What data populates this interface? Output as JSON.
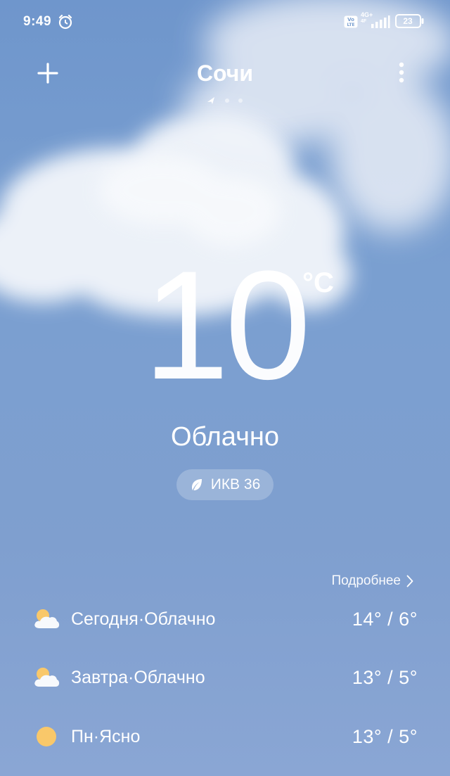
{
  "status_bar": {
    "time": "9:49",
    "network_label": "4G+",
    "network_sub": "4F",
    "volte": "VoLTE",
    "battery": "23",
    "icons": [
      "alarm-icon",
      "volte-icon",
      "signal-icon",
      "battery-icon"
    ]
  },
  "header": {
    "city": "Сочи",
    "add_icon": "plus-icon",
    "menu_icon": "more-vertical-icon",
    "pages_total": 3,
    "current_page": 1
  },
  "current": {
    "temperature": "10",
    "unit": "°C",
    "condition": "Облачно",
    "aqi_label": "ИКВ 36",
    "aqi_icon": "leaf-icon"
  },
  "forecast": {
    "more_label": "Подробнее",
    "days": [
      {
        "label": "Сегодня·Облачно",
        "temps": "14° / 6°",
        "icon": "partly-cloudy-icon"
      },
      {
        "label": "Завтра·Облачно",
        "temps": "13° / 5°",
        "icon": "partly-cloudy-icon"
      },
      {
        "label": "Пн·Ясно",
        "temps": "13° / 5°",
        "icon": "sun-icon"
      }
    ]
  },
  "colors": {
    "sky_top": "#6f96cc",
    "sky_bottom": "#8aa6d4",
    "sun": "#f9c86a"
  }
}
